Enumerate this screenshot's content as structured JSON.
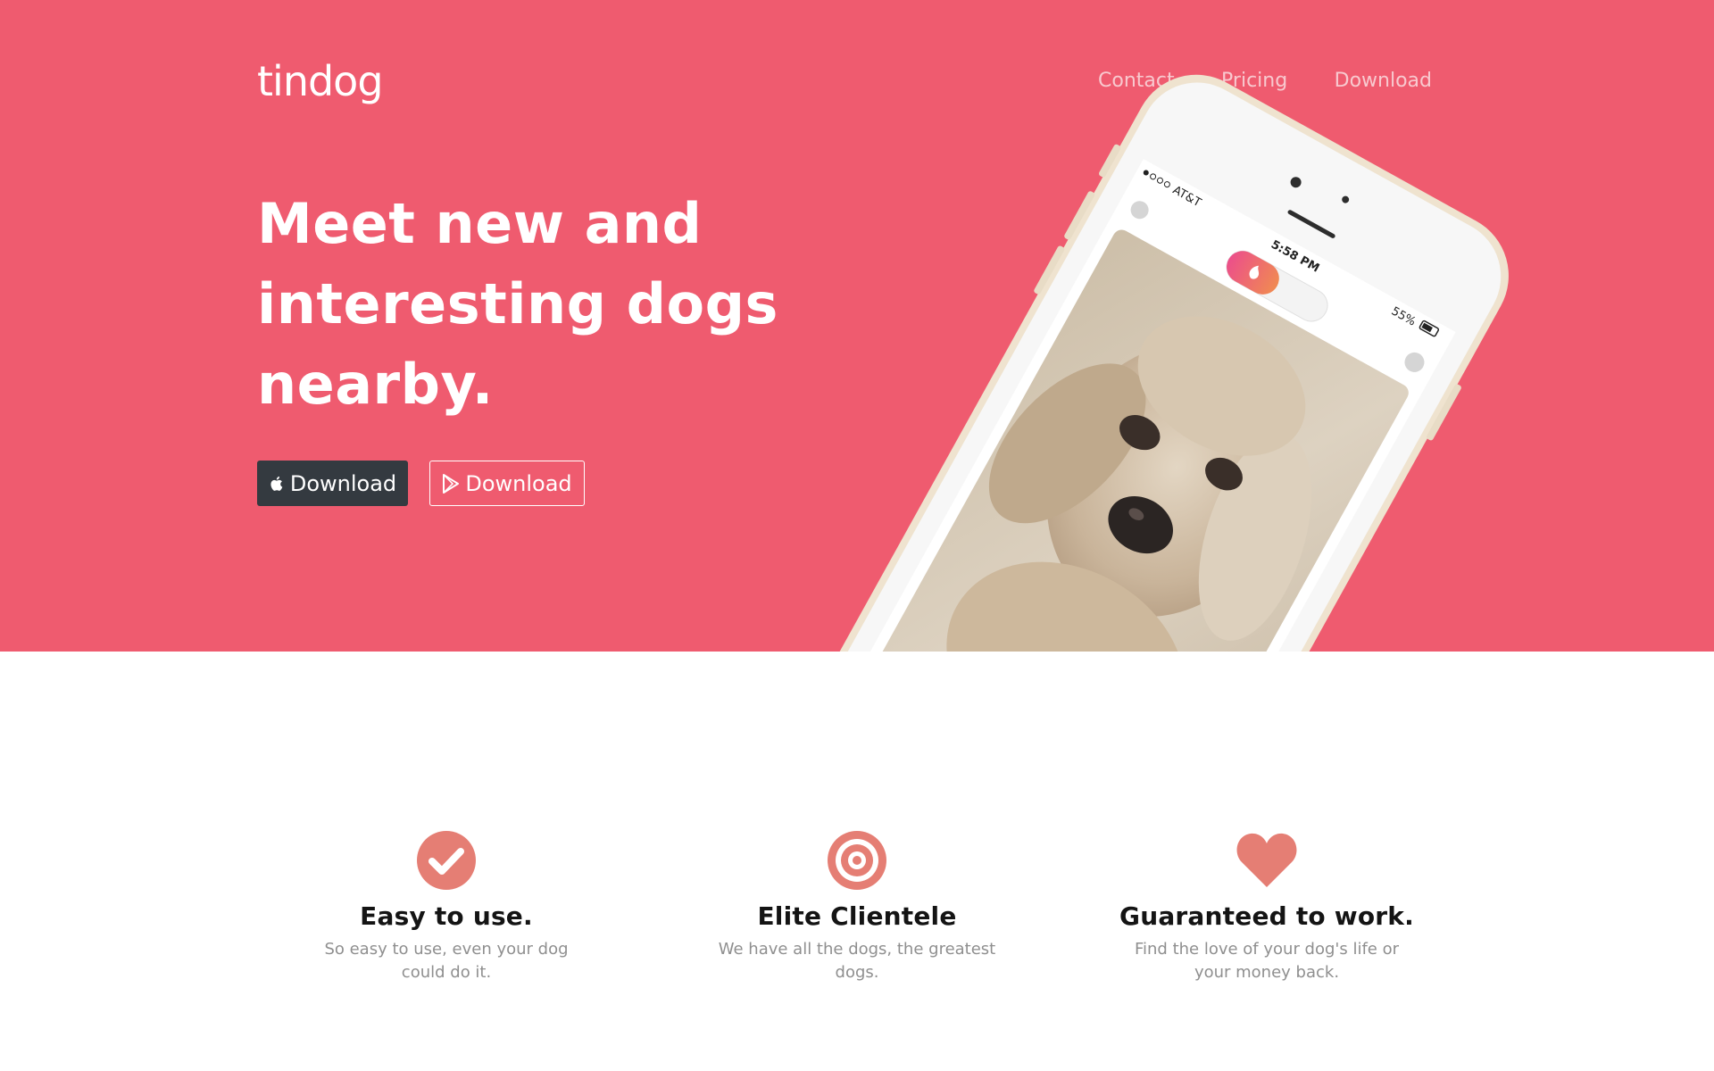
{
  "brand": {
    "name": "tindog"
  },
  "nav": {
    "items": [
      "Contact",
      "Pricing",
      "Download"
    ]
  },
  "hero": {
    "headline_lines": [
      "Meet new and",
      "interesting dogs",
      "nearby."
    ],
    "apple_button_label": "Download",
    "play_button_label": "Download"
  },
  "phone": {
    "carrier": "AT&T",
    "time": "5:58 PM",
    "battery": "55%"
  },
  "features": [
    {
      "icon": "check-circle-icon",
      "title": "Easy to use.",
      "text": "So easy to use, even your dog could do it."
    },
    {
      "icon": "bullseye-icon",
      "title": "Elite Clientele",
      "text": "We have all the dogs, the greatest dogs."
    },
    {
      "icon": "heart-icon",
      "title": "Guaranteed to work.",
      "text": "Find the love of your dog's life or your money back."
    }
  ],
  "colors": {
    "hero_bg": "#ef5b6f",
    "icon": "#e57e74",
    "dark_button": "#343a40"
  }
}
